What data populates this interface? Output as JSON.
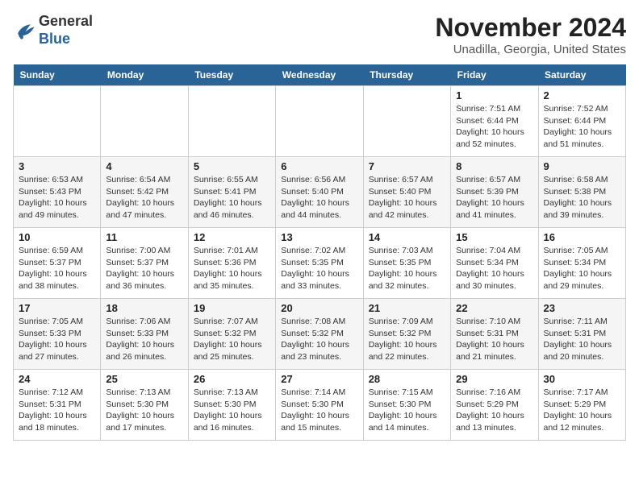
{
  "logo": {
    "general": "General",
    "blue": "Blue"
  },
  "title": "November 2024",
  "subtitle": "Unadilla, Georgia, United States",
  "weekdays": [
    "Sunday",
    "Monday",
    "Tuesday",
    "Wednesday",
    "Thursday",
    "Friday",
    "Saturday"
  ],
  "weeks": [
    [
      {
        "day": "",
        "info": ""
      },
      {
        "day": "",
        "info": ""
      },
      {
        "day": "",
        "info": ""
      },
      {
        "day": "",
        "info": ""
      },
      {
        "day": "",
        "info": ""
      },
      {
        "day": "1",
        "info": "Sunrise: 7:51 AM\nSunset: 6:44 PM\nDaylight: 10 hours and 52 minutes."
      },
      {
        "day": "2",
        "info": "Sunrise: 7:52 AM\nSunset: 6:44 PM\nDaylight: 10 hours and 51 minutes."
      }
    ],
    [
      {
        "day": "3",
        "info": "Sunrise: 6:53 AM\nSunset: 5:43 PM\nDaylight: 10 hours and 49 minutes."
      },
      {
        "day": "4",
        "info": "Sunrise: 6:54 AM\nSunset: 5:42 PM\nDaylight: 10 hours and 47 minutes."
      },
      {
        "day": "5",
        "info": "Sunrise: 6:55 AM\nSunset: 5:41 PM\nDaylight: 10 hours and 46 minutes."
      },
      {
        "day": "6",
        "info": "Sunrise: 6:56 AM\nSunset: 5:40 PM\nDaylight: 10 hours and 44 minutes."
      },
      {
        "day": "7",
        "info": "Sunrise: 6:57 AM\nSunset: 5:40 PM\nDaylight: 10 hours and 42 minutes."
      },
      {
        "day": "8",
        "info": "Sunrise: 6:57 AM\nSunset: 5:39 PM\nDaylight: 10 hours and 41 minutes."
      },
      {
        "day": "9",
        "info": "Sunrise: 6:58 AM\nSunset: 5:38 PM\nDaylight: 10 hours and 39 minutes."
      }
    ],
    [
      {
        "day": "10",
        "info": "Sunrise: 6:59 AM\nSunset: 5:37 PM\nDaylight: 10 hours and 38 minutes."
      },
      {
        "day": "11",
        "info": "Sunrise: 7:00 AM\nSunset: 5:37 PM\nDaylight: 10 hours and 36 minutes."
      },
      {
        "day": "12",
        "info": "Sunrise: 7:01 AM\nSunset: 5:36 PM\nDaylight: 10 hours and 35 minutes."
      },
      {
        "day": "13",
        "info": "Sunrise: 7:02 AM\nSunset: 5:35 PM\nDaylight: 10 hours and 33 minutes."
      },
      {
        "day": "14",
        "info": "Sunrise: 7:03 AM\nSunset: 5:35 PM\nDaylight: 10 hours and 32 minutes."
      },
      {
        "day": "15",
        "info": "Sunrise: 7:04 AM\nSunset: 5:34 PM\nDaylight: 10 hours and 30 minutes."
      },
      {
        "day": "16",
        "info": "Sunrise: 7:05 AM\nSunset: 5:34 PM\nDaylight: 10 hours and 29 minutes."
      }
    ],
    [
      {
        "day": "17",
        "info": "Sunrise: 7:05 AM\nSunset: 5:33 PM\nDaylight: 10 hours and 27 minutes."
      },
      {
        "day": "18",
        "info": "Sunrise: 7:06 AM\nSunset: 5:33 PM\nDaylight: 10 hours and 26 minutes."
      },
      {
        "day": "19",
        "info": "Sunrise: 7:07 AM\nSunset: 5:32 PM\nDaylight: 10 hours and 25 minutes."
      },
      {
        "day": "20",
        "info": "Sunrise: 7:08 AM\nSunset: 5:32 PM\nDaylight: 10 hours and 23 minutes."
      },
      {
        "day": "21",
        "info": "Sunrise: 7:09 AM\nSunset: 5:32 PM\nDaylight: 10 hours and 22 minutes."
      },
      {
        "day": "22",
        "info": "Sunrise: 7:10 AM\nSunset: 5:31 PM\nDaylight: 10 hours and 21 minutes."
      },
      {
        "day": "23",
        "info": "Sunrise: 7:11 AM\nSunset: 5:31 PM\nDaylight: 10 hours and 20 minutes."
      }
    ],
    [
      {
        "day": "24",
        "info": "Sunrise: 7:12 AM\nSunset: 5:31 PM\nDaylight: 10 hours and 18 minutes."
      },
      {
        "day": "25",
        "info": "Sunrise: 7:13 AM\nSunset: 5:30 PM\nDaylight: 10 hours and 17 minutes."
      },
      {
        "day": "26",
        "info": "Sunrise: 7:13 AM\nSunset: 5:30 PM\nDaylight: 10 hours and 16 minutes."
      },
      {
        "day": "27",
        "info": "Sunrise: 7:14 AM\nSunset: 5:30 PM\nDaylight: 10 hours and 15 minutes."
      },
      {
        "day": "28",
        "info": "Sunrise: 7:15 AM\nSunset: 5:30 PM\nDaylight: 10 hours and 14 minutes."
      },
      {
        "day": "29",
        "info": "Sunrise: 7:16 AM\nSunset: 5:29 PM\nDaylight: 10 hours and 13 minutes."
      },
      {
        "day": "30",
        "info": "Sunrise: 7:17 AM\nSunset: 5:29 PM\nDaylight: 10 hours and 12 minutes."
      }
    ]
  ]
}
